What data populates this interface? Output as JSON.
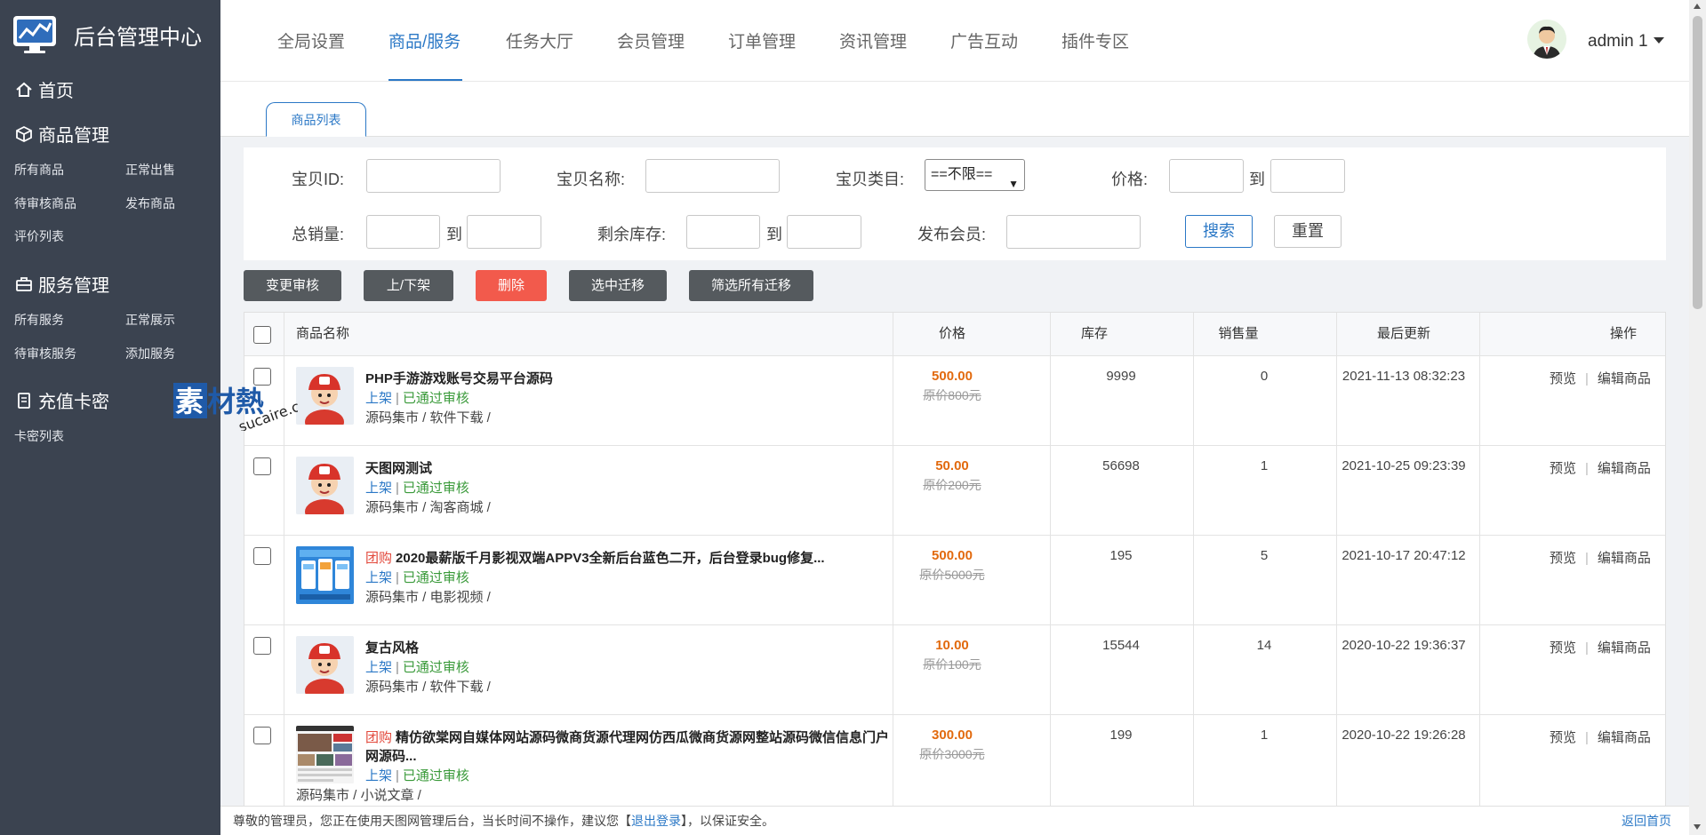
{
  "brand": {
    "title": "后台管理中心"
  },
  "sidebar": {
    "home": "首页",
    "groups": [
      {
        "title": "商品管理",
        "items": [
          "所有商品",
          "正常出售",
          "待审核商品",
          "发布商品",
          "评价列表"
        ]
      },
      {
        "title": "服务管理",
        "items": [
          "所有服务",
          "正常展示",
          "待审核服务",
          "添加服务"
        ]
      },
      {
        "title": "充值卡密",
        "items": [
          "卡密列表"
        ]
      }
    ]
  },
  "header": {
    "tabs": [
      "全局设置",
      "商品/服务",
      "任务大厅",
      "会员管理",
      "订单管理",
      "资讯管理",
      "广告互动",
      "插件专区"
    ],
    "active_tab": "商品/服务",
    "username": "admin 1"
  },
  "subtab": "商品列表",
  "filter": {
    "id_label": "宝贝ID:",
    "name_label": "宝贝名称:",
    "category_label": "宝贝类目:",
    "category_value": "==不限==",
    "price_label": "价格:",
    "to": "到",
    "sales_label": "总销量:",
    "stock_label": "剩余库存:",
    "member_label": "发布会员:",
    "search": "搜索",
    "reset": "重置"
  },
  "actions": [
    "变更审核",
    "上/下架",
    "删除",
    "选中迁移",
    "筛选所有迁移"
  ],
  "table": {
    "headers": [
      "商品名称",
      "价格",
      "库存",
      "销售量",
      "最后更新",
      "操作"
    ],
    "rows": [
      {
        "tag": "",
        "name": "PHP手游游戏账号交易平台源码",
        "status_on": "上架",
        "status_ok": "已通过审核",
        "category": "源码集市 / 软件下载 /",
        "price": "500.00",
        "orig": "原价800元",
        "stock": "9999",
        "sales": "0",
        "updated": "2021-11-13 08:32:23"
      },
      {
        "tag": "",
        "name": "天图网测试",
        "status_on": "上架",
        "status_ok": "已通过审核",
        "category": "源码集市 / 淘客商城 /",
        "price": "50.00",
        "orig": "原价200元",
        "stock": "56698",
        "sales": "1",
        "updated": "2021-10-25 09:23:39"
      },
      {
        "tag": "团购",
        "name": "2020最薪版千月影视双端APPV3全新后台蓝色二开，后台登录bug修复...",
        "status_on": "上架",
        "status_ok": "已通过审核",
        "category": "源码集市 / 电影视频 /",
        "price": "500.00",
        "orig": "原价5000元",
        "stock": "195",
        "sales": "5",
        "updated": "2021-10-17 20:47:12"
      },
      {
        "tag": "",
        "name": "复古风格",
        "status_on": "上架",
        "status_ok": "已通过审核",
        "category": "源码集市 / 软件下载 /",
        "price": "10.00",
        "orig": "原价100元",
        "stock": "15544",
        "sales": "14",
        "updated": "2020-10-22 19:36:37"
      },
      {
        "tag": "团购",
        "name": "精仿欲棠网自媒体网站源码微商货源代理网仿西瓜微商货源网整站源码微信信息门户",
        "name2": "网源码...",
        "status_on": "上架",
        "status_ok": "已通过审核",
        "category": "源码集市 / 小说文章 /",
        "price": "300.00",
        "orig": "原价3000元",
        "stock": "199",
        "sales": "1",
        "updated": "2020-10-22 19:26:28"
      }
    ],
    "op_preview": "预览",
    "op_edit": "编辑商品"
  },
  "footer": {
    "text_before": "尊敬的管理员，您正在使用天图网管理后台，当长时间不操作，建议您【",
    "logout": "退出登录",
    "text_after": "】，以保证安全。",
    "home": "返回首页"
  },
  "watermark": {
    "text": "素材熱",
    "domain": "sucaire.com"
  },
  "colors": {
    "sidebar": "#3b4350",
    "accent": "#2b78c6",
    "danger": "#f25a4c",
    "price": "#e26a0e",
    "approved": "#3a9a3a"
  }
}
